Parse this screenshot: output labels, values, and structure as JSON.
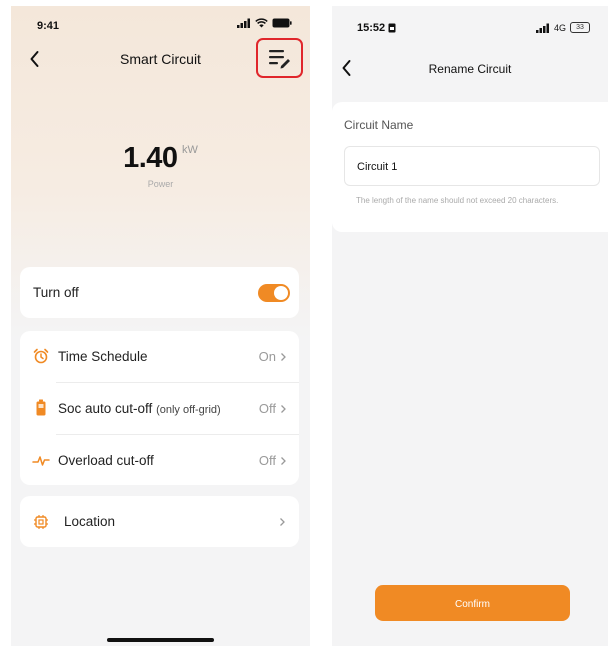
{
  "left": {
    "status_time": "9:41",
    "title": "Smart Circuit",
    "power_value": "1.40",
    "power_unit": "kW",
    "power_label": "Power",
    "turn_off_label": "Turn off",
    "turn_off_on": true,
    "settings": [
      {
        "label": "Time Schedule",
        "value": "On"
      },
      {
        "label": "Soc auto cut-off",
        "sub": "(only off-grid)",
        "value": "Off"
      },
      {
        "label": "Overload cut-off",
        "value": "Off"
      }
    ],
    "location_label": "Location"
  },
  "right": {
    "status_time": "15:52",
    "network": "4G",
    "battery": "33",
    "title": "Rename Circuit",
    "section_label": "Circuit Name",
    "input_value": "Circuit 1",
    "hint": "The length of the name should not exceed 20 characters.",
    "confirm_label": "Confirm"
  },
  "colors": {
    "accent": "#f08a24",
    "highlight": "#e0262b"
  }
}
